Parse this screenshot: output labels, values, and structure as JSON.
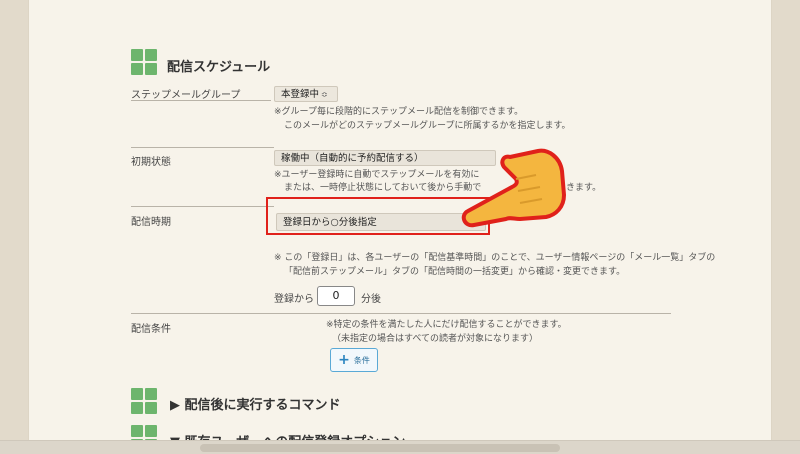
{
  "sections": {
    "schedule_title": "配信スケジュール",
    "after_command_title": "▶ 配信後に実行するコマンド",
    "existing_users_title": "▼ 既存ユーザーへの配信登録オプション"
  },
  "step_group": {
    "label": "ステップメールグループ",
    "value": "本登録中",
    "note_line1": "※グループ毎に段階的にステップメール配信を制御できます。",
    "note_line2": "このメールがどのステップメールグループに所属するかを指定します。"
  },
  "initial_state": {
    "label": "初期状態",
    "value": "稼働中（自動的に予約配信する）",
    "note_line1": "※ユーザー登録時に自動でステップメールを有効に",
    "note_line2": "または、一時停止状態にしておいて後から手動で",
    "note_line2_tail": "きます。"
  },
  "timing": {
    "label": "配信時期",
    "value": "登録日から○分後指定",
    "note_line1": "※ この「登録日」は、各ユーザーの「配信基準時間」のことで、ユーザー情報ページの「メール一覧」タブの",
    "note_line2": "「配信前ステップメール」タブの「配信時間の一括変更」から確認・変更できます。",
    "prefix": "登録から",
    "minutes": "0",
    "suffix": "分後"
  },
  "conditions": {
    "label": "配信条件",
    "note_line1": "※特定の条件を満たした人にだけ配信することができます。",
    "note_line2": "（未指定の場合はすべての読者が対象になります）",
    "button_label": "条件"
  },
  "colors": {
    "accent_green": "#6db56d",
    "highlight_red": "#e0211b",
    "hand_yellow": "#f4b63f"
  }
}
